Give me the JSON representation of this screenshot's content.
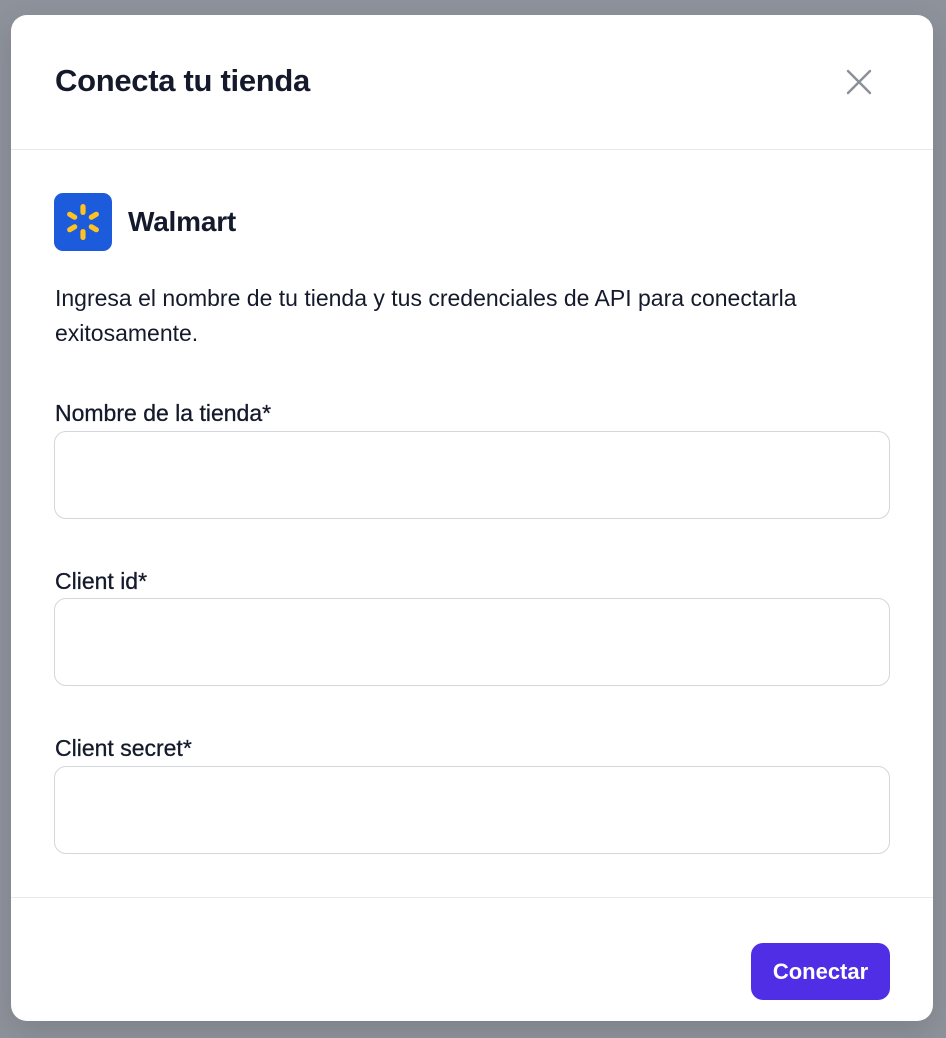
{
  "modal": {
    "title": "Conecta tu tienda",
    "close_icon": "close-icon"
  },
  "store": {
    "name": "Walmart",
    "logo_icon": "walmart-spark-icon",
    "logo_bg_color": "#1d5bdd",
    "logo_spark_color": "#ffc220"
  },
  "description": "Ingresa el nombre de tu tienda y tus credenciales de API para conectarla exitosamente.",
  "form": {
    "store_name": {
      "label": "Nombre de la tienda*",
      "value": "",
      "placeholder": ""
    },
    "client_id": {
      "label": "Client id*",
      "value": "",
      "placeholder": ""
    },
    "client_secret": {
      "label": "Client secret*",
      "value": "",
      "placeholder": ""
    }
  },
  "footer": {
    "connect_label": "Conectar",
    "accent_color": "#4f2ee6"
  }
}
